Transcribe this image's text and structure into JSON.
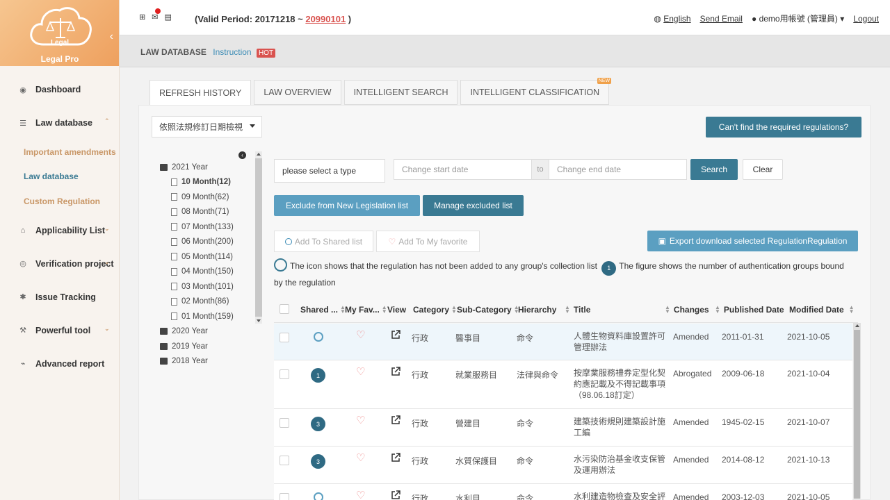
{
  "brand": {
    "logo_text": "Legal",
    "name": "Legal Pro"
  },
  "sidebar": {
    "items": [
      {
        "label": "Dashboard",
        "icon": "dashboard-icon"
      },
      {
        "label": "Law database",
        "icon": "database-icon",
        "caret": "up"
      },
      {
        "label": "Applicability List",
        "icon": "home-icon",
        "caret": "down"
      },
      {
        "label": "Verification project",
        "icon": "eye-slash-icon",
        "caret": "down"
      },
      {
        "label": "Issue Tracking",
        "icon": "bug-icon"
      },
      {
        "label": "Powerful tool",
        "icon": "wrench-icon",
        "caret": "down"
      },
      {
        "label": "Advanced report",
        "icon": "line-chart-icon"
      }
    ],
    "sub_items": [
      {
        "label": "Important amendments",
        "active": false
      },
      {
        "label": "Law database",
        "active": true
      },
      {
        "label": "Custom Regulation",
        "active": false
      }
    ]
  },
  "header": {
    "valid_prefix": "(Valid Period: 20171218 ~ ",
    "valid_end": "20990101",
    "valid_suffix": " )",
    "language": "English",
    "send_email": "Send Email",
    "user": "demo用帳號 (管理員)",
    "logout": "Logout"
  },
  "breadcrumb": {
    "title": "LAW DATABASE",
    "link": "Instruction",
    "badge": "HOT"
  },
  "tabs": [
    {
      "label": "REFRESH HISTORY",
      "active": true
    },
    {
      "label": "LAW OVERVIEW",
      "active": false
    },
    {
      "label": "INTELLIGENT SEARCH",
      "active": false
    },
    {
      "label": "INTELLIGENT CLASSIFICATION",
      "active": false,
      "badge": "NEW"
    }
  ],
  "sort_select": {
    "value": "依照法規修訂日期檢視"
  },
  "cant_find_button": "Can't find the required regulations?",
  "tree": {
    "years": [
      {
        "label": "2021 Year",
        "expanded": true
      },
      {
        "label": "2020 Year"
      },
      {
        "label": "2019 Year"
      },
      {
        "label": "2018 Year"
      }
    ],
    "months": [
      {
        "label": "10 Month(12)",
        "selected": true
      },
      {
        "label": "09 Month(62)"
      },
      {
        "label": "08 Month(71)"
      },
      {
        "label": "07 Month(133)"
      },
      {
        "label": "06 Month(200)"
      },
      {
        "label": "05 Month(114)"
      },
      {
        "label": "04 Month(150)"
      },
      {
        "label": "03 Month(101)"
      },
      {
        "label": "02 Month(86)"
      },
      {
        "label": "01 Month(159)"
      }
    ]
  },
  "filters": {
    "type_placeholder": "please select a type",
    "start_placeholder": "Change start date",
    "to": "to",
    "end_placeholder": "Change end date",
    "search": "Search",
    "clear": "Clear"
  },
  "actions": {
    "exclude": "Exclude from New Legislation list",
    "manage": "Manage excluded list",
    "add_shared": "Add To Shared list",
    "add_favorite": "Add To My favorite",
    "export": "Export download selected RegulationRegulation"
  },
  "legend": {
    "circle_text": "The icon shows that the regulation has not been added to any group's collection list",
    "badge_value": "1",
    "badge_text": "The figure shows the number of authentication groups bound by the regulation"
  },
  "table": {
    "columns": [
      "Shared ...",
      "My Fav...",
      "View",
      "Category",
      "Sub-Category",
      "Hierarchy",
      "Title",
      "Changes",
      "Published Date",
      "Modified Date"
    ],
    "rows": [
      {
        "shared": "",
        "category": "行政",
        "sub": "醫事目",
        "hierarchy": "命令",
        "title": "人體生物資料庫設置許可管理辦法",
        "changes": "Amended",
        "published": "2011-01-31",
        "modified": "2021-10-05"
      },
      {
        "shared": "1",
        "category": "行政",
        "sub": "就業服務目",
        "hierarchy": "法律與命令",
        "title": "按摩業服務禮券定型化契約應記載及不得記載事項（98.06.18訂定）",
        "changes": "Abrogated",
        "published": "2009-06-18",
        "modified": "2021-10-04"
      },
      {
        "shared": "3",
        "category": "行政",
        "sub": "營建目",
        "hierarchy": "命令",
        "title": "建築技術規則建築設計施工編",
        "changes": "Amended",
        "published": "1945-02-15",
        "modified": "2021-10-07"
      },
      {
        "shared": "3",
        "category": "行政",
        "sub": "水質保護目",
        "hierarchy": "命令",
        "title": "水污染防治基金收支保管及運用辦法",
        "changes": "Amended",
        "published": "2014-08-12",
        "modified": "2021-10-13"
      },
      {
        "shared": "",
        "category": "行政",
        "sub": "水利目",
        "hierarchy": "命令",
        "title": "水利建造物檢查及安全評",
        "changes": "Amended",
        "published": "2003-12-03",
        "modified": "2021-10-05"
      }
    ]
  }
}
